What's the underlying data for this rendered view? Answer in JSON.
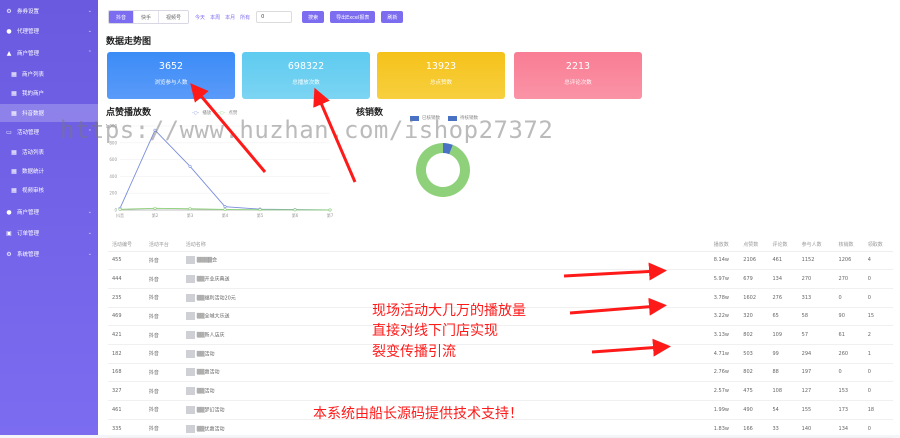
{
  "sidebar": {
    "items": [
      {
        "label": "券券设置",
        "icon": "gear-icon",
        "glyph": "⚙",
        "chev": "⌄"
      },
      {
        "label": "代理管理",
        "icon": "user-icon",
        "glyph": "●",
        "chev": "⌄"
      },
      {
        "label": "商户管理",
        "icon": "store-icon",
        "glyph": "▲",
        "chev": "⌃"
      },
      {
        "label": "商户列表",
        "icon": "list-icon",
        "glyph": "▦"
      },
      {
        "label": "我的商户",
        "icon": "list-icon",
        "glyph": "▦"
      },
      {
        "label": "抖音数据",
        "icon": "grid-icon",
        "glyph": "▦"
      },
      {
        "label": "活动管理",
        "icon": "activity-icon",
        "glyph": "▭",
        "chev": "⌃"
      },
      {
        "label": "活动列表",
        "icon": "list-icon",
        "glyph": "▦"
      },
      {
        "label": "数据统计",
        "icon": "chart-icon",
        "glyph": "▦"
      },
      {
        "label": "视频审核",
        "icon": "video-icon",
        "glyph": "▦"
      },
      {
        "label": "商户管理",
        "icon": "user-icon",
        "glyph": "●",
        "chev": "⌄"
      },
      {
        "label": "订单管理",
        "icon": "cart-icon",
        "glyph": "▣",
        "chev": "⌄"
      },
      {
        "label": "系统管理",
        "icon": "gear-icon",
        "glyph": "⚙",
        "chev": "⌄"
      }
    ]
  },
  "toolbar": {
    "platforms": [
      "抖音",
      "快手",
      "视频号"
    ],
    "ranges": [
      "今天",
      "本周",
      "本月",
      "所有"
    ],
    "date_value": "0",
    "query_label": "搜索",
    "export_label": "导出Excel报表",
    "refresh_label": "刷新"
  },
  "overview": {
    "title": "数据走势图",
    "cards": [
      {
        "value": "3652",
        "label": "浏览参与人数",
        "color": "#4a7ef4"
      },
      {
        "value": "698322",
        "label": "总播放次数",
        "color": "#5fc3ec"
      },
      {
        "value": "13923",
        "label": "总点赞数",
        "color": "#f4c425"
      },
      {
        "value": "2213",
        "label": "总评论次数",
        "color": "#f7849a"
      }
    ]
  },
  "chart_data": [
    {
      "type": "line",
      "title": "点赞播放数",
      "x": [
        "1",
        "2",
        "3",
        "4",
        "5",
        "6",
        "7"
      ],
      "series": [
        {
          "name": "播放",
          "color": "#7a8ddb",
          "values": [
            20,
            950,
            520,
            40,
            10,
            5,
            0
          ]
        },
        {
          "name": "点赞",
          "color": "#8fd17b",
          "values": [
            8,
            20,
            15,
            6,
            3,
            2,
            0
          ]
        }
      ],
      "yticks": [
        "0",
        "200",
        "400",
        "600",
        "800",
        "1,000"
      ],
      "xticks": [
        "抖音",
        "第2",
        "第3",
        "第4",
        "第5",
        "第6",
        "第7"
      ],
      "ylim": [
        0,
        1000
      ]
    },
    {
      "type": "pie",
      "title": "核销数",
      "slices": [
        {
          "name": "已核销数",
          "value": 6,
          "color": "#4a72c4"
        },
        {
          "name": "待核销数",
          "value": 94,
          "color": "#8fd17b"
        }
      ]
    }
  ],
  "table": {
    "headers": [
      "活动编号",
      "活动平台",
      "活动名称",
      "",
      "",
      "",
      "",
      "",
      "",
      "播放数",
      "点赞数",
      "评论数",
      "参与人数",
      "核销数",
      "领取数"
    ],
    "rows": [
      [
        "455",
        "抖音",
        "▒▒▒▒会",
        "8.14w",
        "2106",
        "461",
        "1152",
        "1206",
        "4"
      ],
      [
        "444",
        "抖音",
        "▒▒开业庆典送",
        "5.97w",
        "679",
        "134",
        "270",
        "270",
        "0"
      ],
      [
        "235",
        "抖音",
        "▒▒福利活动20元",
        "3.78w",
        "1602",
        "276",
        "313",
        "0",
        "0"
      ],
      [
        "469",
        "抖音",
        "▒▒全城大乐送",
        "3.22w",
        "320",
        "65",
        "58",
        "90",
        "15"
      ],
      [
        "421",
        "抖音",
        "▒▒新人店庆",
        "3.13w",
        "802",
        "109",
        "57",
        "61",
        "2"
      ],
      [
        "182",
        "抖音",
        "▒▒活动",
        "4.71w",
        "503",
        "99",
        "294",
        "260",
        "1"
      ],
      [
        "168",
        "抖音",
        "▒▒惠活动",
        "2.76w",
        "802",
        "88",
        "197",
        "0",
        "0"
      ],
      [
        "327",
        "抖音",
        "▒▒活动",
        "2.57w",
        "475",
        "108",
        "127",
        "153",
        "0"
      ],
      [
        "461",
        "抖音",
        "▒▒梦幻活动",
        "1.99w",
        "490",
        "54",
        "155",
        "173",
        "18"
      ],
      [
        "335",
        "抖音",
        "▒▒优惠活动",
        "1.83w",
        "166",
        "33",
        "140",
        "134",
        "0"
      ]
    ]
  },
  "watermark": "https://www.huzhan.com/ishop27372",
  "annotations": {
    "line1": "现场活动大几万的播放量",
    "line2": "直接对线下门店实现",
    "line3": "裂变传播引流",
    "footer": "本系统由船长源码提供技术支持！"
  }
}
